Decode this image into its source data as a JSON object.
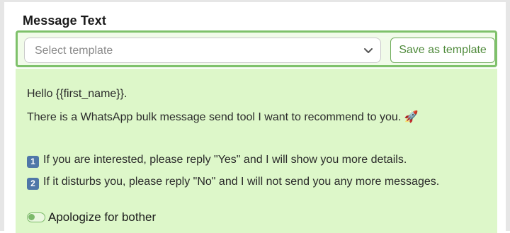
{
  "section": {
    "heading": "Message Text"
  },
  "template_select": {
    "placeholder": "Select template",
    "icon": "chevron-down-icon"
  },
  "save_template_button": {
    "label": "Save as template"
  },
  "message": {
    "line1": "Hello {{first_name}}.",
    "line2": "There is a WhatsApp bulk message send tool I want to recommend to you. 🚀",
    "item1_key": "1",
    "item1_text": "If you are interested, please reply \"Yes\" and I will show you more details.",
    "item2_key": "2",
    "item2_text": "If it disturbs you, please reply \"No\" and I will not send you any more messages."
  },
  "apologize_toggle": {
    "label": "Apologize for bother",
    "enabled": false
  },
  "colors": {
    "accent_green": "#7ec16a",
    "message_background": "#ddf7c9",
    "button_text": "#4f8a3b"
  }
}
